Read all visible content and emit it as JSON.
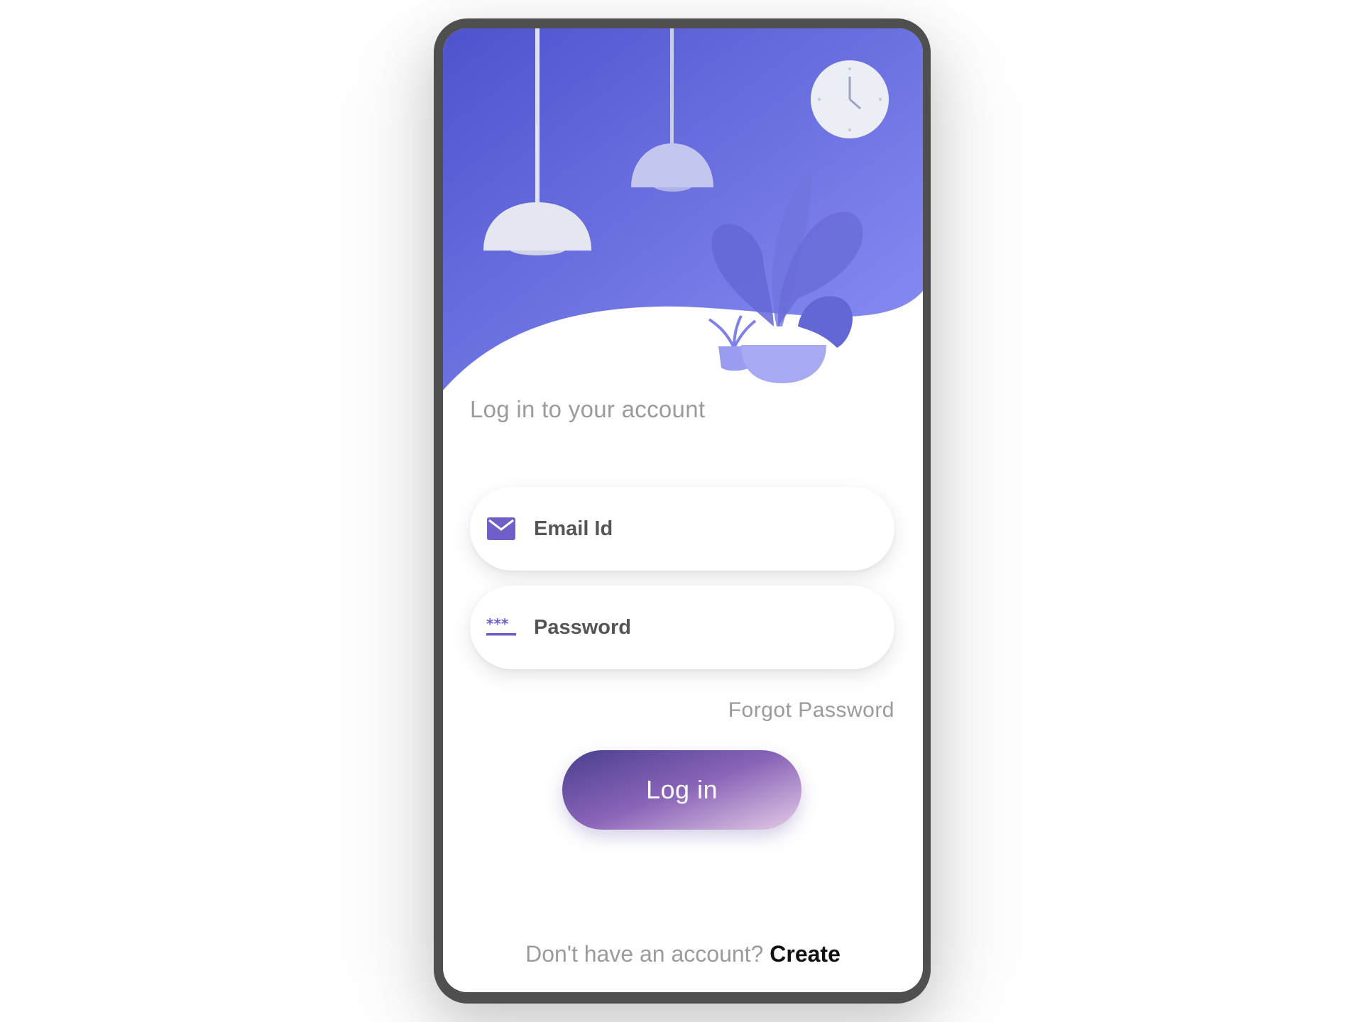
{
  "colors": {
    "hero_top": "#4f55d0",
    "hero_bottom": "#8b8ff5",
    "accent": "#6f5fc7",
    "text_muted": "#9b9b9b",
    "text_strong": "#111111"
  },
  "login": {
    "title": "Log in to your account",
    "email_placeholder": "Email Id",
    "email_icon": "mail-icon",
    "password_placeholder": "Password",
    "password_icon": "password-icon",
    "forgot_label": "Forgot Password",
    "button_label": "Log in",
    "signup_prompt": "Don't have an account?",
    "signup_link": "Create"
  },
  "illustration": {
    "items": [
      "pendant-lamp",
      "pendant-lamp",
      "wall-clock",
      "potted-plant"
    ]
  }
}
